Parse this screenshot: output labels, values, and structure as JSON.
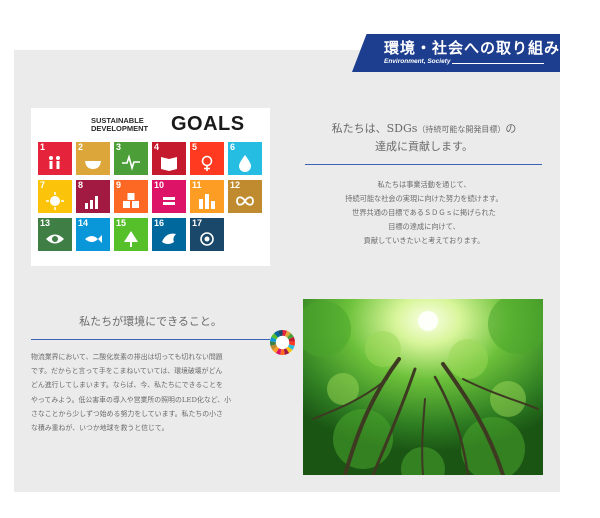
{
  "banner": {
    "title": "環境・社会への取り組み",
    "subtitle": "Environment, Society",
    "color": "#1d3e8f"
  },
  "sdgs": {
    "logo_line1": "SUSTAINABLE",
    "logo_line2": "DEVELOPMENT",
    "logo_goals": "GOALS",
    "goals": [
      {
        "num": "1",
        "color": "#e5243b",
        "icon": "family-icon"
      },
      {
        "num": "2",
        "color": "#dda63a",
        "icon": "bowl-icon"
      },
      {
        "num": "3",
        "color": "#4c9f38",
        "icon": "heartbeat-icon"
      },
      {
        "num": "4",
        "color": "#c5192d",
        "icon": "book-icon"
      },
      {
        "num": "5",
        "color": "#ff3a21",
        "icon": "gender-icon"
      },
      {
        "num": "6",
        "color": "#26bde2",
        "icon": "water-drop-icon"
      },
      {
        "num": "7",
        "color": "#fcc30b",
        "icon": "sun-icon"
      },
      {
        "num": "8",
        "color": "#a21942",
        "icon": "chart-up-icon"
      },
      {
        "num": "9",
        "color": "#fd6925",
        "icon": "cubes-icon"
      },
      {
        "num": "10",
        "color": "#dd1367",
        "icon": "equality-icon"
      },
      {
        "num": "11",
        "color": "#fd9d24",
        "icon": "buildings-icon"
      },
      {
        "num": "12",
        "color": "#bf8b2e",
        "icon": "infinity-icon"
      },
      {
        "num": "13",
        "color": "#3f7e44",
        "icon": "eye-globe-icon"
      },
      {
        "num": "14",
        "color": "#0a97d9",
        "icon": "fish-icon"
      },
      {
        "num": "15",
        "color": "#56c02b",
        "icon": "tree-icon"
      },
      {
        "num": "16",
        "color": "#00689d",
        "icon": "dove-icon"
      },
      {
        "num": "17",
        "color": "#19486a",
        "icon": "rings-icon"
      }
    ]
  },
  "right": {
    "heading_line1_a": "私たちは、SDGs",
    "heading_line1_small": "（持続可能な開発目標）",
    "heading_line1_b": "の",
    "heading_line2": "達成に貢献します。",
    "body": [
      "私たちは事業活動を通じて、",
      "持続可能な社会の実現に向けた努力を続けます。",
      "世界共通の目標であるＳＤＧｓに掲げられた",
      "目標の達成に向けて、",
      "貢献していきたいと考えております。"
    ]
  },
  "left": {
    "heading": "私たちが環境にできること。",
    "body": [
      "物流業界において、二酸化炭素の排出は切っても切れない問題",
      "です。だからと言って手をこまねいていては、環境破壊がどん",
      "どん進行してしまいます。ならば、今、私たちにできることを",
      "やってみよう。低公害車の導入や営業所の照明のLED化など、小",
      "さなことから少しずつ始める努力をしています。私たちの小さ",
      "な積み重ねが、いつか地球を救うと信じて。"
    ]
  },
  "accent_color": "#3f63b4"
}
